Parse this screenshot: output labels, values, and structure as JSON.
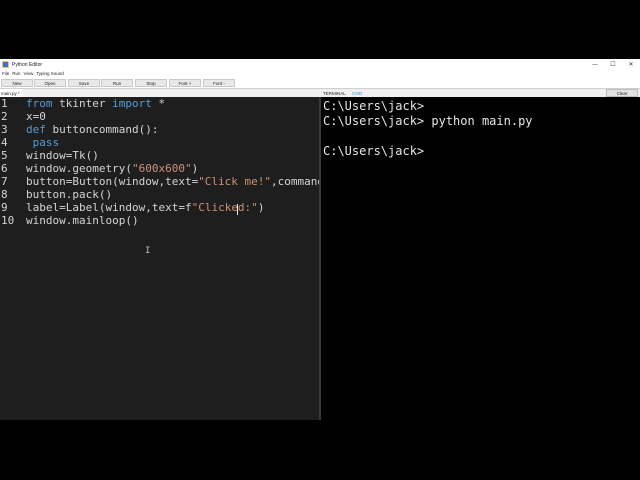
{
  "window": {
    "title": "Python Editor"
  },
  "window_controls": {
    "minimize": "—",
    "maximize": "☐",
    "close": "✕"
  },
  "menu": [
    "File",
    "Run",
    "View",
    "Typing Sound"
  ],
  "toolbar": {
    "new": "New",
    "open": "Open",
    "save": "Save",
    "run": "Run",
    "stop": "Stop",
    "font_plus": "Font +",
    "font_minus": "Font -"
  },
  "editor_tab": "main.py *",
  "terminal_tabs": {
    "terminal": "TERMINAL",
    "cmd": "CMD"
  },
  "clear_label": "Clear",
  "line_numbers": [
    "1",
    "2",
    "3",
    "4",
    "5",
    "6",
    "7",
    "8",
    "9",
    "10"
  ],
  "code": {
    "l1_kw1": "from",
    "l1_mod": " tkinter ",
    "l1_kw2": "import",
    "l1_rest": " *",
    "l2": "x=0",
    "l3_kw": "def",
    "l3_rest": " buttoncommand():",
    "l4": " pass",
    "l5": "window=Tk()",
    "l6_a": "window.geometry(",
    "l6_str": "\"600x600\"",
    "l6_b": ")",
    "l7_a": "button=Button(window,text=",
    "l7_str": "\"Click me!\"",
    "l7_b": ",command=bu",
    "l8": "button.pack()",
    "l9_a": "label=Label(window,text=f",
    "l9_str": "\"Clicked:\"",
    "l9_b": ")",
    "l10": "window.mainloop()"
  },
  "terminal": [
    "C:\\Users\\jack>",
    "C:\\Users\\jack> python main.py",
    "",
    "C:\\Users\\jack>"
  ],
  "colors": {
    "keyword": "#569cd6",
    "string": "#ce9178",
    "text": "#d4d4d4",
    "cmd_tab": "#3b8ed8"
  }
}
